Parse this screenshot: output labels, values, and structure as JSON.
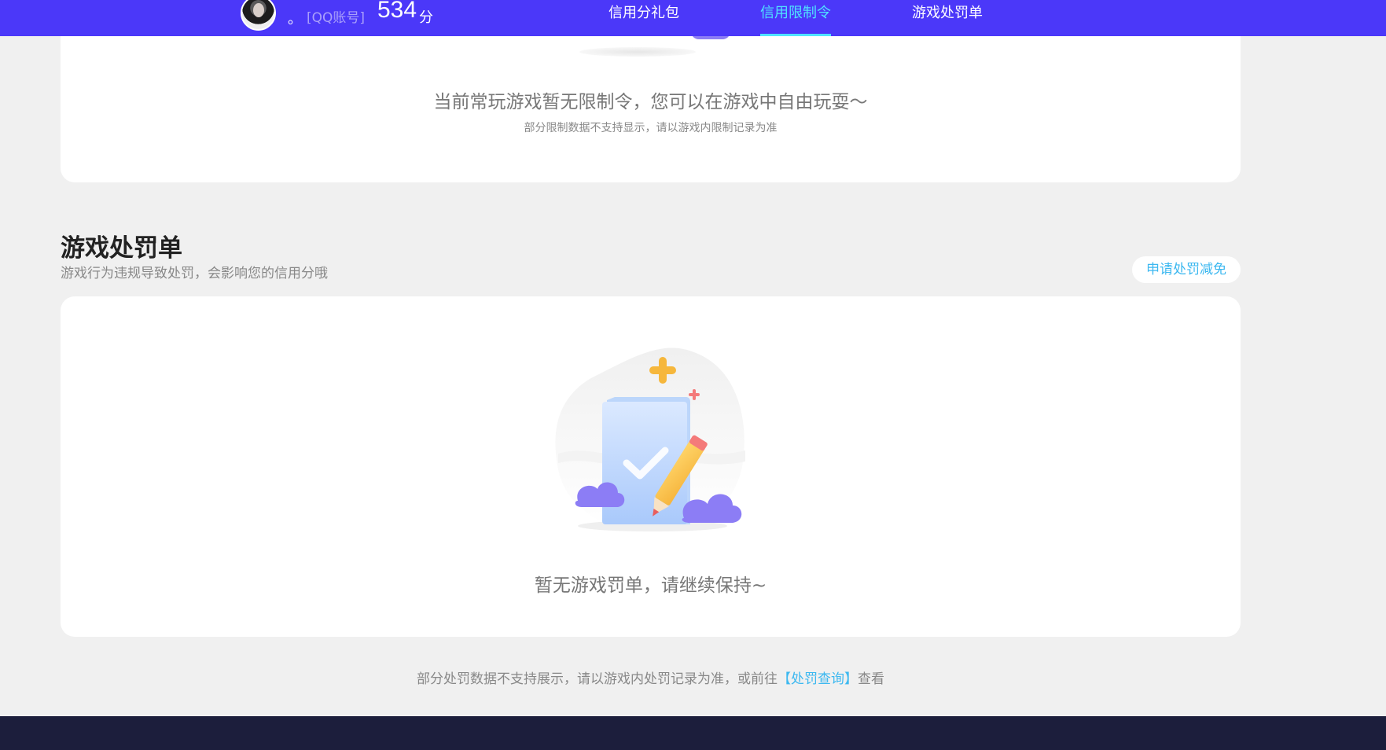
{
  "header": {
    "nickname": "。",
    "account_type": "[QQ账号]",
    "score": "534",
    "score_unit": "分",
    "nav": [
      {
        "label": "信用分礼包",
        "active": false
      },
      {
        "label": "信用限制令",
        "active": true
      },
      {
        "label": "游戏处罚单",
        "active": false
      }
    ]
  },
  "restriction": {
    "empty_text": "当前常玩游戏暂无限制令，您可以在游戏中自由玩耍～",
    "note": "部分限制数据不支持显示，请以游戏内限制记录为准"
  },
  "penalty": {
    "title": "游戏处罚单",
    "subtitle": "游戏行为违规导致处罚，会影响您的信用分哦",
    "apply_button": "申请处罚减免",
    "empty_text": "暂无游戏罚单，请继续保持~"
  },
  "footer_note": {
    "prefix": "部分处罚数据不支持展示，请以游戏内处罚记录为准，或前往",
    "link": "【处罚查询】",
    "suffix": "查看"
  },
  "colors": {
    "header_bg": "#4b38f9",
    "accent": "#4fe3ff",
    "link": "#3cb8f0",
    "footer_bg": "#1c1e3c"
  }
}
